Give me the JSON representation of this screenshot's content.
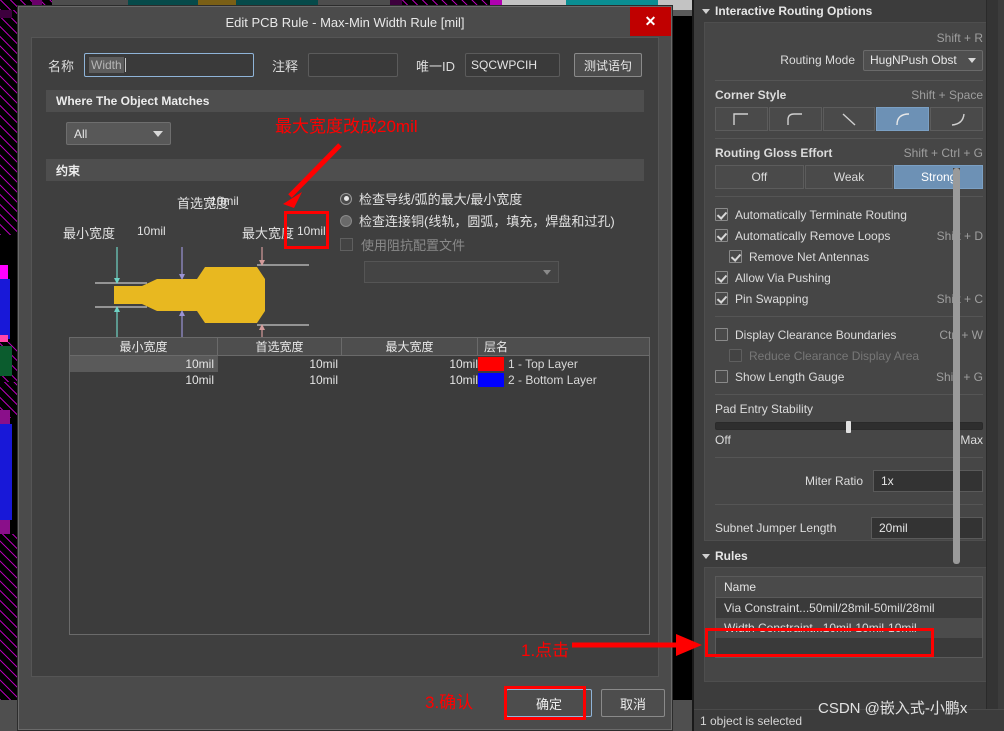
{
  "dialog": {
    "title": "Edit PCB Rule - Max-Min Width Rule [mil]",
    "close_label": "✕",
    "name_label": "名称",
    "name_value": "Width",
    "comment_label": "注释",
    "comment_value": "",
    "uid_label": "唯一ID",
    "uid_value": "SQCWPCIH",
    "test_button": "测试语句",
    "where_section": "Where The Object Matches",
    "scope_value": "All",
    "constraint_section": "约束",
    "preferred_width_label": "首选宽度",
    "preferred_width_value": "10mil",
    "min_width_label": "最小宽度",
    "min_width_value": "10mil",
    "max_width_label": "最大宽度",
    "max_width_value": "10mil",
    "radio_1": "检查导线/弧的最大/最小宽度",
    "radio_2": "检查连接铜(线轨，圆弧，填充，焊盘和过孔)",
    "impedance_checkbox": "使用阻抗配置文件",
    "impedance_value": "",
    "table": {
      "columns": [
        "最小宽度",
        "首选宽度",
        "最大宽度",
        "层名"
      ],
      "rows": [
        {
          "min": "10mil",
          "preferred": "10mil",
          "max": "10mil",
          "layer": "1 - Top Layer",
          "color": "#ff0000",
          "selected": true
        },
        {
          "min": "10mil",
          "preferred": "10mil",
          "max": "10mil",
          "layer": "2 - Bottom Layer",
          "color": "#0000ff",
          "selected": false
        }
      ]
    },
    "ok_button": "确定",
    "cancel_button": "取消"
  },
  "panel": {
    "header": "Interactive Routing Options",
    "routing_mode_shortcut": "Shift + R",
    "routing_mode_label": "Routing Mode",
    "routing_mode_value": "HugNPush Obst",
    "corner_style_label": "Corner Style",
    "corner_style_shortcut": "Shift + Space",
    "corner_styles": [
      {
        "name": "corner-90",
        "selected": false
      },
      {
        "name": "corner-rounded-90",
        "selected": false
      },
      {
        "name": "corner-45",
        "selected": false
      },
      {
        "name": "corner-arc",
        "selected": true
      },
      {
        "name": "corner-arc-wide",
        "selected": false
      }
    ],
    "gloss_label": "Routing Gloss Effort",
    "gloss_shortcut": "Shift + Ctrl + G",
    "gloss_options": [
      {
        "label": "Off",
        "selected": false
      },
      {
        "label": "Weak",
        "selected": false
      },
      {
        "label": "Strong",
        "selected": true
      }
    ],
    "checkboxes": [
      {
        "label": "Automatically Terminate Routing",
        "checked": true,
        "shortcut": "",
        "indent": false,
        "disabled": false
      },
      {
        "label": "Automatically Remove Loops",
        "checked": true,
        "shortcut": "Shift + D",
        "indent": false,
        "disabled": false
      },
      {
        "label": "Remove Net Antennas",
        "checked": true,
        "shortcut": "",
        "indent": true,
        "disabled": false
      },
      {
        "label": "Allow Via Pushing",
        "checked": true,
        "shortcut": "",
        "indent": false,
        "disabled": false
      },
      {
        "label": "Pin Swapping",
        "checked": true,
        "shortcut": "Shift + C",
        "indent": false,
        "disabled": false
      }
    ],
    "checkboxes2": [
      {
        "label": "Display Clearance Boundaries",
        "checked": false,
        "shortcut": "Ctrl + W",
        "indent": false,
        "disabled": false
      },
      {
        "label": "Reduce Clearance Display Area",
        "checked": false,
        "shortcut": "",
        "indent": true,
        "disabled": true
      },
      {
        "label": "Show Length Gauge",
        "checked": false,
        "shortcut": "Shift + G",
        "indent": false,
        "disabled": false
      }
    ],
    "pad_entry_label": "Pad Entry Stability",
    "pad_entry_min": "Off",
    "pad_entry_max": "Max",
    "miter_ratio_label": "Miter Ratio",
    "miter_ratio_value": "1x",
    "subnet_label": "Subnet Jumper Length",
    "subnet_value": "20mil",
    "rules_header": "Rules",
    "rules_col_name": "Name",
    "rules": [
      {
        "label": "Via Constraint...50mil/28mil-50mil/28mil",
        "selected": false
      },
      {
        "label": "Width Constraint...10mil-10mil-10mil",
        "selected": true
      }
    ],
    "status": "1 object is selected"
  },
  "annotations": {
    "note_max_width": "最大宽度改成20mil",
    "step1": "1.点击",
    "step3": "3.确认",
    "watermark": "CSDN @嵌入式-小鹏x"
  },
  "colors": {
    "accent": "#6d91b5",
    "annotation": "#ff0000",
    "close": "#c00000",
    "trace": "#e8b820"
  }
}
